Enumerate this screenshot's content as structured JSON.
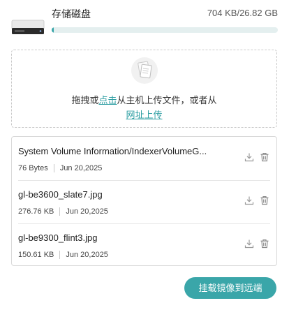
{
  "storage": {
    "title": "存储磁盘",
    "size": "704 KB/26.82 GB",
    "used_fraction": 3e-05,
    "icon": "drive-icon"
  },
  "upload": {
    "text_prefix": "拖拽或",
    "click_link": "点击",
    "text_suffix": "从主机上传文件，或者从",
    "url_link": "网址上传",
    "icon": "upload-documents-icon"
  },
  "files": [
    {
      "name": "System Volume Information/IndexerVolumeG...",
      "size": "76 Bytes",
      "date": "Jun 20,2025"
    },
    {
      "name": "gl-be3600_slate7.jpg",
      "size": "276.76 KB",
      "date": "Jun 20,2025"
    },
    {
      "name": "gl-be9300_flint3.jpg",
      "size": "150.61 KB",
      "date": "Jun 20,2025"
    }
  ],
  "file_actions": [
    "download-icon",
    "trash-icon"
  ],
  "submit_label": "挂载镜像到远端",
  "colors": {
    "accent": "#3aa6a9",
    "progress_track": "#e4efef",
    "link": "#2f9fa3"
  }
}
